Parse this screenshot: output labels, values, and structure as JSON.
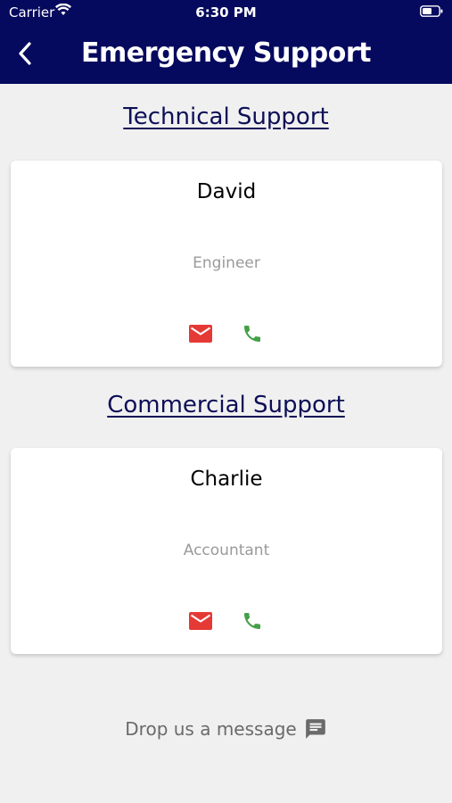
{
  "status_bar": {
    "carrier": "Carrier",
    "time": "6:30 PM"
  },
  "header": {
    "title": "Emergency Support",
    "bg_color": "#050a5e"
  },
  "sections": [
    {
      "title": "Technical Support",
      "contact": {
        "name": "David",
        "role": "Engineer",
        "actions": [
          "mail-icon",
          "phone-icon"
        ]
      }
    },
    {
      "title": "Commercial Support",
      "contact": {
        "name": "Charlie",
        "role": "Accountant",
        "actions": [
          "mail-icon",
          "phone-icon"
        ]
      }
    }
  ],
  "footer": {
    "label": "Drop us a message",
    "icon": "chat-icon"
  },
  "colors": {
    "mail": "#e53935",
    "phone": "#43a047",
    "section_title": "#0d0f57",
    "background": "#f0f0f0"
  }
}
